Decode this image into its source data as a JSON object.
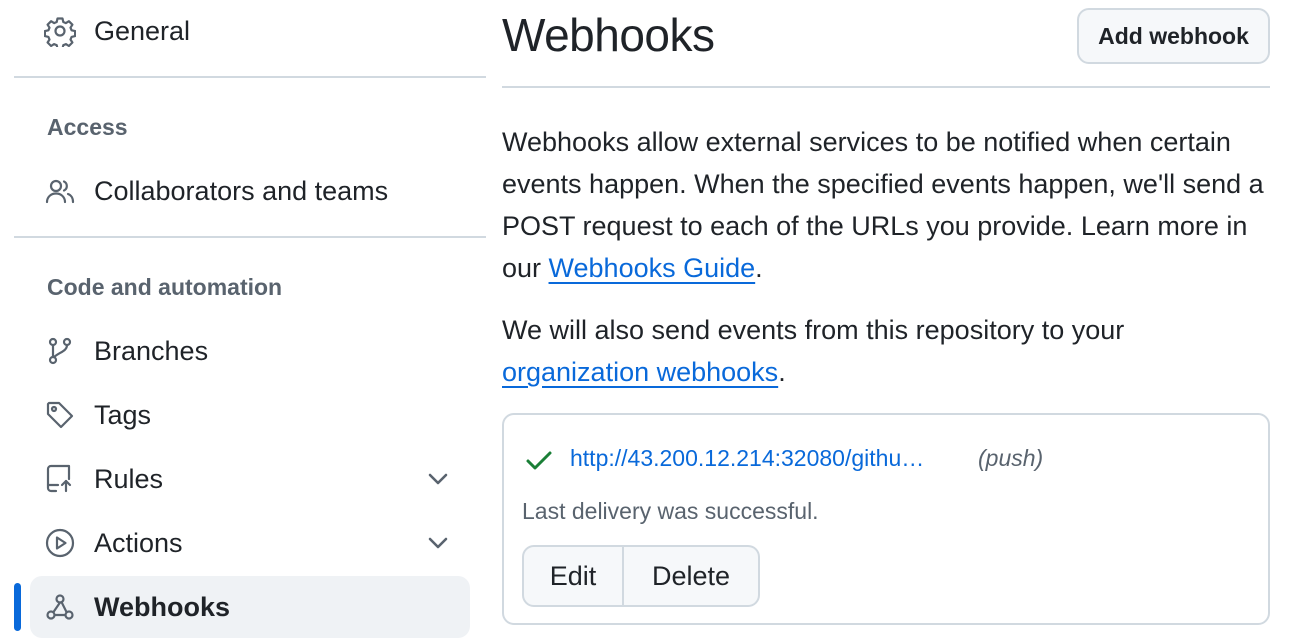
{
  "sidebar": {
    "general": {
      "label": "General",
      "icon": "gear-icon"
    },
    "access_heading": "Access",
    "collaborators": {
      "label": "Collaborators and teams",
      "icon": "people-icon"
    },
    "code_heading": "Code and automation",
    "branches": {
      "label": "Branches",
      "icon": "git-branch-icon"
    },
    "tags": {
      "label": "Tags",
      "icon": "tag-icon"
    },
    "rules": {
      "label": "Rules",
      "icon": "repo-push-icon",
      "expandable": true
    },
    "actions": {
      "label": "Actions",
      "icon": "play-icon",
      "expandable": true
    },
    "webhooks": {
      "label": "Webhooks",
      "icon": "webhook-icon",
      "active": true
    }
  },
  "main": {
    "title": "Webhooks",
    "add_button": "Add webhook",
    "desc1_text": "Webhooks allow external services to be notified when certain events happen. When the specified events happen, we'll send a POST request to each of the URLs you provide. Learn more in our ",
    "desc1_link": "Webhooks Guide",
    "desc1_end": ".",
    "desc2_text": "We will also send events from this repository to your ",
    "desc2_link": "organization webhooks",
    "desc2_end": ".",
    "hook": {
      "url": "http://43.200.12.214:32080/githu…",
      "events": "(push)",
      "status": "Last delivery was successful.",
      "edit_label": "Edit",
      "delete_label": "Delete"
    }
  },
  "colors": {
    "accent": "#0969da",
    "success": "#1a7f37",
    "muted": "#59636e",
    "border": "#d1d9e0",
    "active_bg": "#eff2f5"
  }
}
